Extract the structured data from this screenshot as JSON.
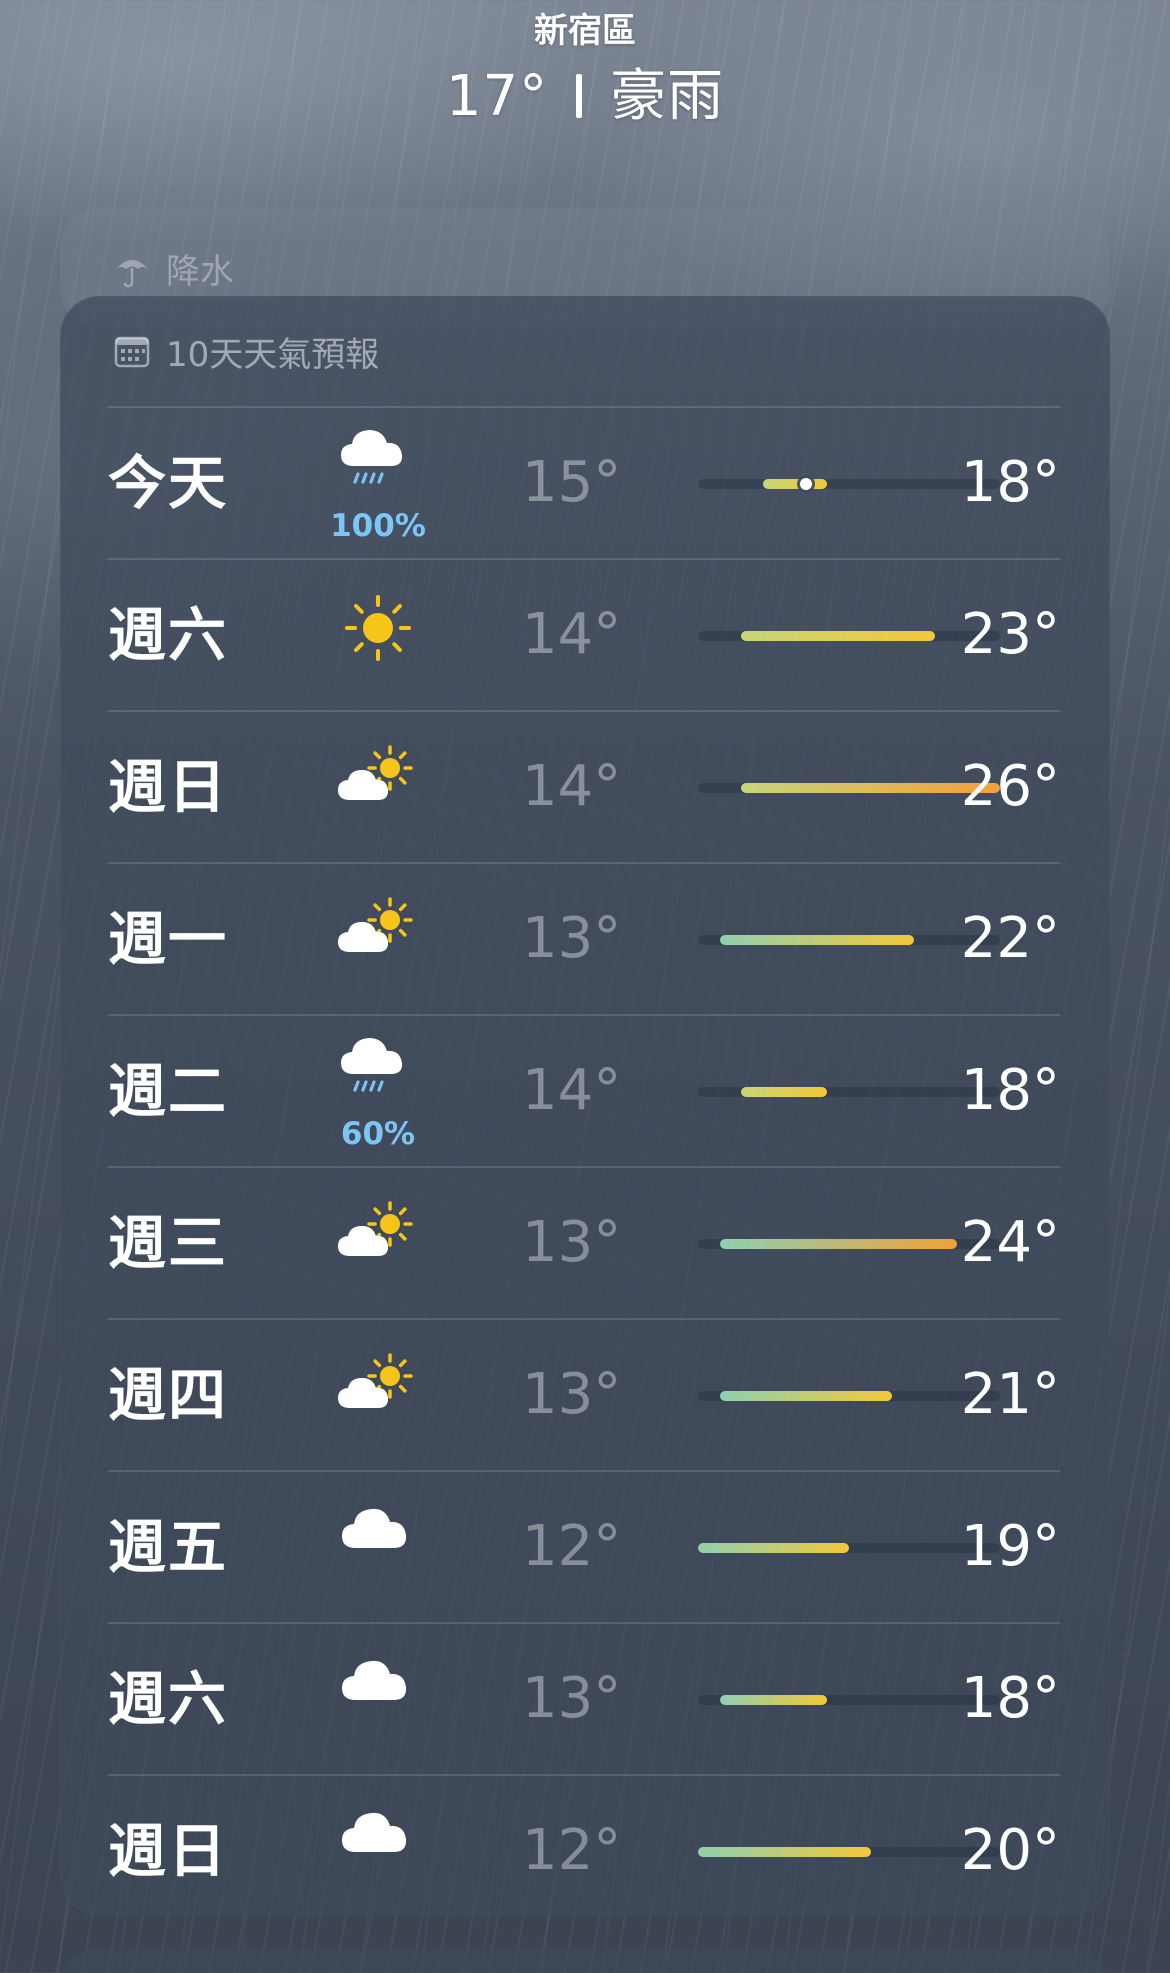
{
  "header": {
    "location": "新宿區",
    "current_temp": "17°",
    "condition": "豪雨"
  },
  "precipitation_card": {
    "label": "降水",
    "icon": "umbrella-icon"
  },
  "forecast": {
    "title": "10天天氣預報",
    "icon": "calendar-icon",
    "range_min": 12,
    "range_max": 26,
    "current_temp": 17,
    "days": [
      {
        "day": "今天",
        "icon": "cloud-rain-icon",
        "pop": "100%",
        "low": "15°",
        "high": "18°",
        "low_v": 15,
        "high_v": 18,
        "current": true
      },
      {
        "day": "週六",
        "icon": "sun-icon",
        "pop": "",
        "low": "14°",
        "high": "23°",
        "low_v": 14,
        "high_v": 23
      },
      {
        "day": "週日",
        "icon": "partly-sunny-icon",
        "pop": "",
        "low": "14°",
        "high": "26°",
        "low_v": 14,
        "high_v": 26
      },
      {
        "day": "週一",
        "icon": "partly-sunny-icon",
        "pop": "",
        "low": "13°",
        "high": "22°",
        "low_v": 13,
        "high_v": 22
      },
      {
        "day": "週二",
        "icon": "cloud-rain-icon",
        "pop": "60%",
        "low": "14°",
        "high": "18°",
        "low_v": 14,
        "high_v": 18
      },
      {
        "day": "週三",
        "icon": "partly-sunny-icon",
        "pop": "",
        "low": "13°",
        "high": "24°",
        "low_v": 13,
        "high_v": 24
      },
      {
        "day": "週四",
        "icon": "partly-sunny-icon",
        "pop": "",
        "low": "13°",
        "high": "21°",
        "low_v": 13,
        "high_v": 21
      },
      {
        "day": "週五",
        "icon": "cloud-icon",
        "pop": "",
        "low": "12°",
        "high": "19°",
        "low_v": 12,
        "high_v": 19
      },
      {
        "day": "週六",
        "icon": "cloud-icon",
        "pop": "",
        "low": "13°",
        "high": "18°",
        "low_v": 13,
        "high_v": 18
      },
      {
        "day": "週日",
        "icon": "cloud-icon",
        "pop": "",
        "low": "12°",
        "high": "20°",
        "low_v": 12,
        "high_v": 20
      }
    ]
  },
  "colors": {
    "pop_text": "#7cc6f5",
    "cool": "#8fd0b0",
    "mild": "#c7d67a",
    "warm": "#f3c83a",
    "hot": "#f2a03b"
  }
}
